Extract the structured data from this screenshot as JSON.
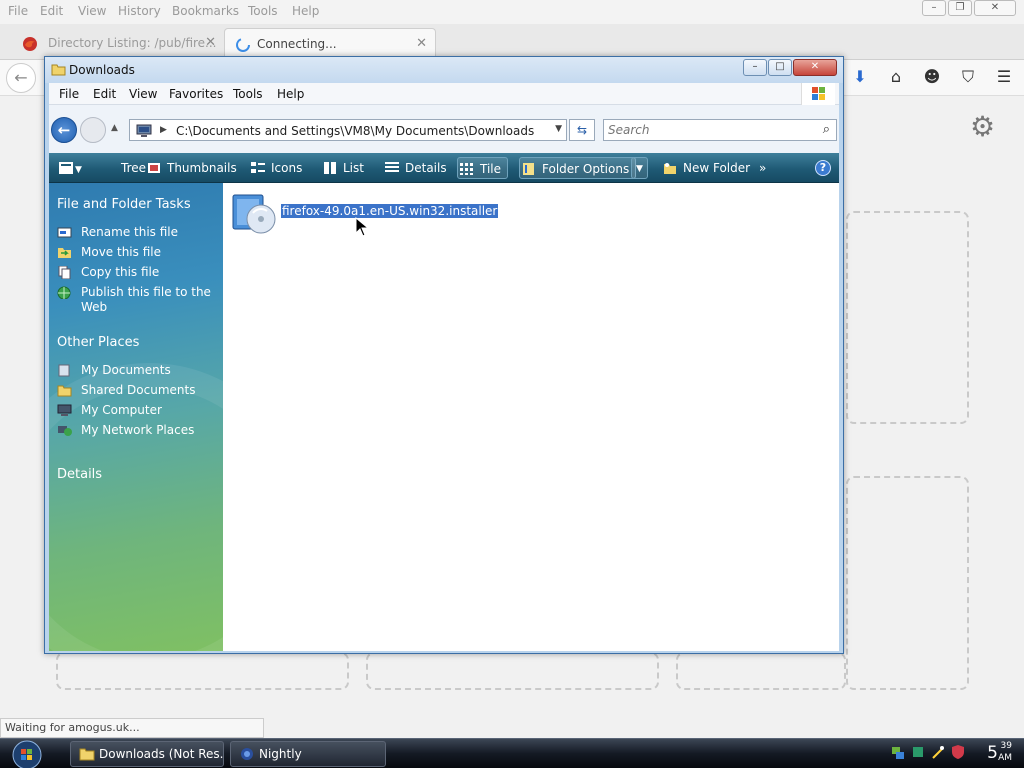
{
  "firefox": {
    "menu": [
      "File",
      "Edit",
      "View",
      "History",
      "Bookmarks",
      "Tools",
      "Help"
    ],
    "tabs": [
      {
        "title": "Directory Listing: /pub/fire...",
        "active": false
      },
      {
        "title": "Connecting...",
        "active": true
      }
    ],
    "status_text": "Waiting for amogus.uk...",
    "nav_icons": [
      "download-icon",
      "home-icon",
      "chat-icon",
      "pocket-icon",
      "hamburger-menu-icon"
    ]
  },
  "explorer": {
    "title": "Downloads",
    "menu": [
      "File",
      "Edit",
      "View",
      "Favorites",
      "Tools",
      "Help"
    ],
    "address": "C:\\Documents and Settings\\VM8\\My Documents\\Downloads",
    "search_placeholder": "Search",
    "toolbar": {
      "tree": "Tree",
      "thumbnails": "Thumbnails",
      "icons": "Icons",
      "list": "List",
      "details": "Details",
      "tile": "Tile",
      "folder_options": "Folder Options",
      "new_folder": "New Folder",
      "more": "»",
      "help": "?"
    },
    "left_pane": {
      "file_tasks_title": "File and Folder Tasks",
      "file_tasks": [
        "Rename this file",
        "Move this file",
        "Copy this file",
        "Publish this file to the Web"
      ],
      "other_places_title": "Other Places",
      "other_places": [
        "My Documents",
        "Shared Documents",
        "My Computer",
        "My Network Places"
      ],
      "details_title": "Details"
    },
    "files": [
      {
        "name": "firefox-49.0a1.en-US.win32.installer",
        "selected": true
      }
    ]
  },
  "taskbar": {
    "buttons": [
      {
        "label": "Downloads (Not Res..."
      },
      {
        "label": "Nightly"
      }
    ],
    "clock": {
      "hour": "5",
      "minutes": "39",
      "ampm": "AM"
    }
  },
  "colors": {
    "selection": "#3b73c9",
    "toolbar": "#1f5a75",
    "taskbar": "#141a24"
  }
}
